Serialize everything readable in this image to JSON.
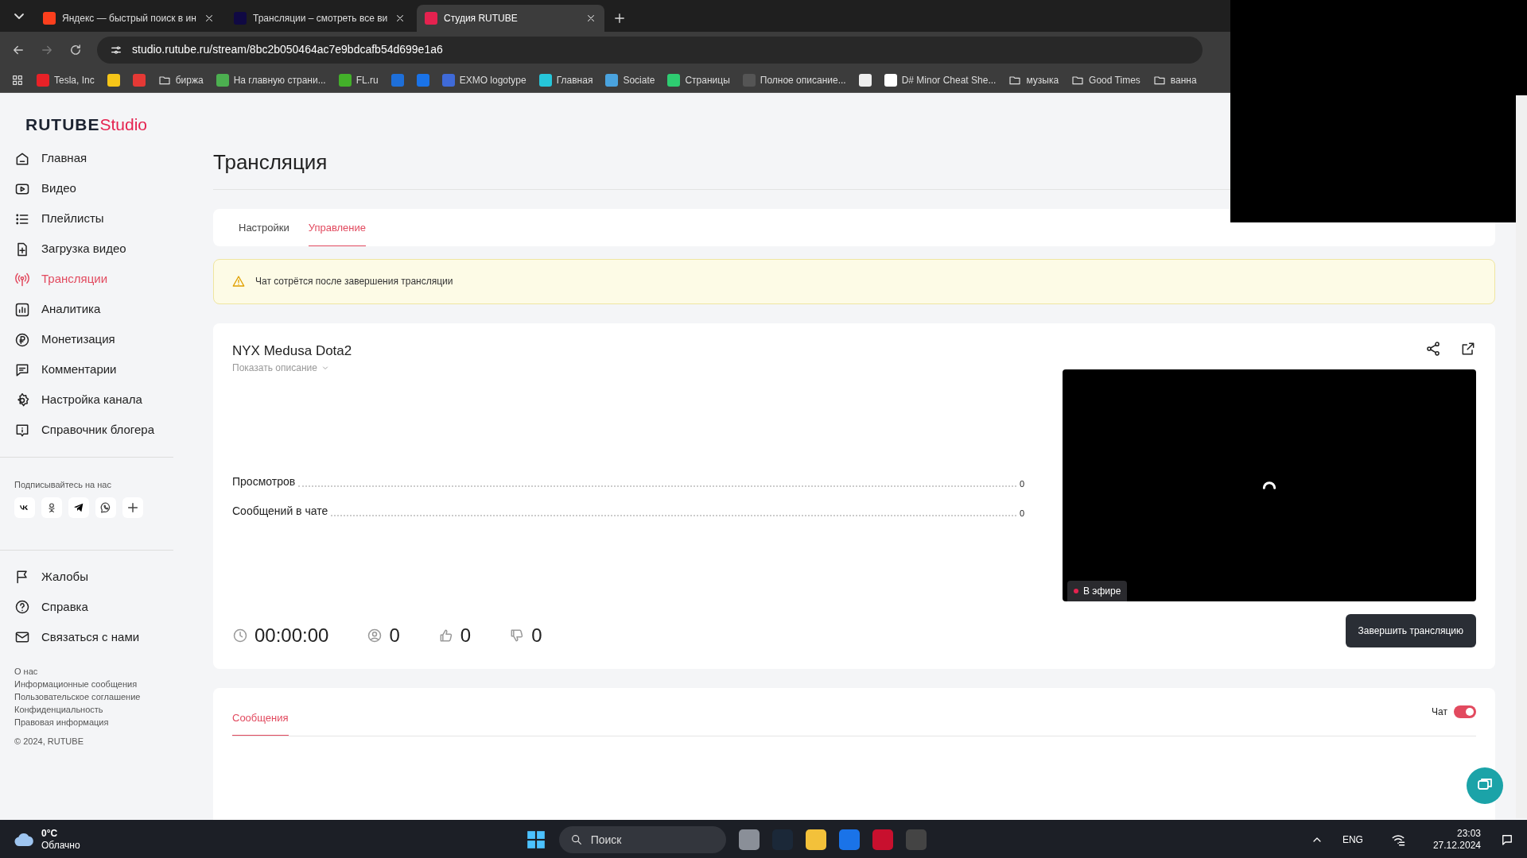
{
  "browser": {
    "tabs": [
      {
        "title": "Яндекс — быстрый поиск в ин",
        "selected": false,
        "color": "#fc3f1d"
      },
      {
        "title": "Трансляции – смотреть все ви",
        "selected": false,
        "color": "#100943"
      },
      {
        "title": "Студия RUTUBE",
        "selected": true,
        "color": "#e5224f"
      }
    ],
    "url": "studio.rutube.ru/stream/8bc2b050464ac7e9bdcafb54d699e1a6",
    "bookmarks": [
      {
        "kind": "site",
        "label": "Tesla, Inc",
        "color": "#e82127"
      },
      {
        "kind": "site",
        "color": "#f5c518"
      },
      {
        "kind": "site",
        "color": "#e53935"
      },
      {
        "kind": "folder",
        "label": "биржа"
      },
      {
        "kind": "site",
        "label": "На главную страни...",
        "color": "#4caf50"
      },
      {
        "kind": "site",
        "label": "FL.ru",
        "color": "#43b02a"
      },
      {
        "kind": "site",
        "color": "#1e6fd9"
      },
      {
        "kind": "site",
        "color": "#1a73e8"
      },
      {
        "kind": "site",
        "label": "EXMO logotype",
        "color": "#3f6ad8"
      },
      {
        "kind": "site",
        "label": "Главная",
        "color": "#26c6da"
      },
      {
        "kind": "site",
        "label": "Sociate",
        "color": "#4aa3df"
      },
      {
        "kind": "site",
        "label": "Страницы",
        "color": "#2ecc71"
      },
      {
        "kind": "site",
        "label": "Полное описание...",
        "color": "#555555"
      },
      {
        "kind": "site",
        "color": "#eeeeee"
      },
      {
        "kind": "site",
        "label": "D# Minor Cheat She...",
        "color": "#ffffff"
      },
      {
        "kind": "folder",
        "label": "музыка"
      },
      {
        "kind": "folder",
        "label": "Good Times"
      },
      {
        "kind": "folder",
        "label": "ванна"
      }
    ]
  },
  "sidebar": {
    "logo": {
      "brand": "RUTUBE",
      "product": "Studio"
    },
    "items": [
      {
        "label": "Главная",
        "selected": false
      },
      {
        "label": "Видео",
        "selected": false
      },
      {
        "label": "Плейлисты",
        "selected": false
      },
      {
        "label": "Загрузка видео",
        "selected": false
      },
      {
        "label": "Трансляции",
        "selected": true
      },
      {
        "label": "Аналитика",
        "selected": false
      },
      {
        "label": "Монетизация",
        "selected": false
      },
      {
        "label": "Комментарии",
        "selected": false
      },
      {
        "label": "Настройка канала",
        "selected": false
      },
      {
        "label": "Справочник блогера",
        "selected": false
      }
    ],
    "social_title": "Подписывайтесь на нас",
    "bottom_items": [
      {
        "label": "Жалобы"
      },
      {
        "label": "Справка"
      },
      {
        "label": "Связаться с нами"
      }
    ],
    "footer_links": [
      "О нас",
      "Информационные сообщения",
      "Пользовательское соглашение",
      "Конфиденциальность",
      "Правовая информация"
    ],
    "copyright": "© 2024, RUTUBE"
  },
  "page": {
    "title": "Трансляция",
    "tabs": [
      {
        "label": "Настройки",
        "selected": false
      },
      {
        "label": "Управление",
        "selected": true
      }
    ],
    "alert": "Чат сотрётся после завершения трансляции",
    "stream": {
      "title": "NYX Medusa Dota2",
      "show_description": "Показать описание",
      "stats": [
        {
          "label": "Просмотров",
          "value": "0"
        },
        {
          "label": "Сообщений в чате",
          "value": "0"
        }
      ],
      "counters": [
        {
          "kind": "time",
          "value": "00:00:00"
        },
        {
          "kind": "viewers",
          "value": "0"
        },
        {
          "kind": "likes",
          "value": "0"
        },
        {
          "kind": "dislikes",
          "value": "0"
        }
      ],
      "live_badge": "В эфире",
      "end_button": "Завершить трансляцию"
    },
    "messages": {
      "tabs": [
        {
          "label": "Сообщения",
          "selected": true
        }
      ],
      "chat_label": "Чат",
      "chat_on": true
    }
  },
  "taskbar": {
    "temperature": "0°C",
    "weather": "Облачно",
    "search_placeholder": "Поиск",
    "language": "ENG",
    "time": "23:03",
    "date": "27.12.2024"
  }
}
